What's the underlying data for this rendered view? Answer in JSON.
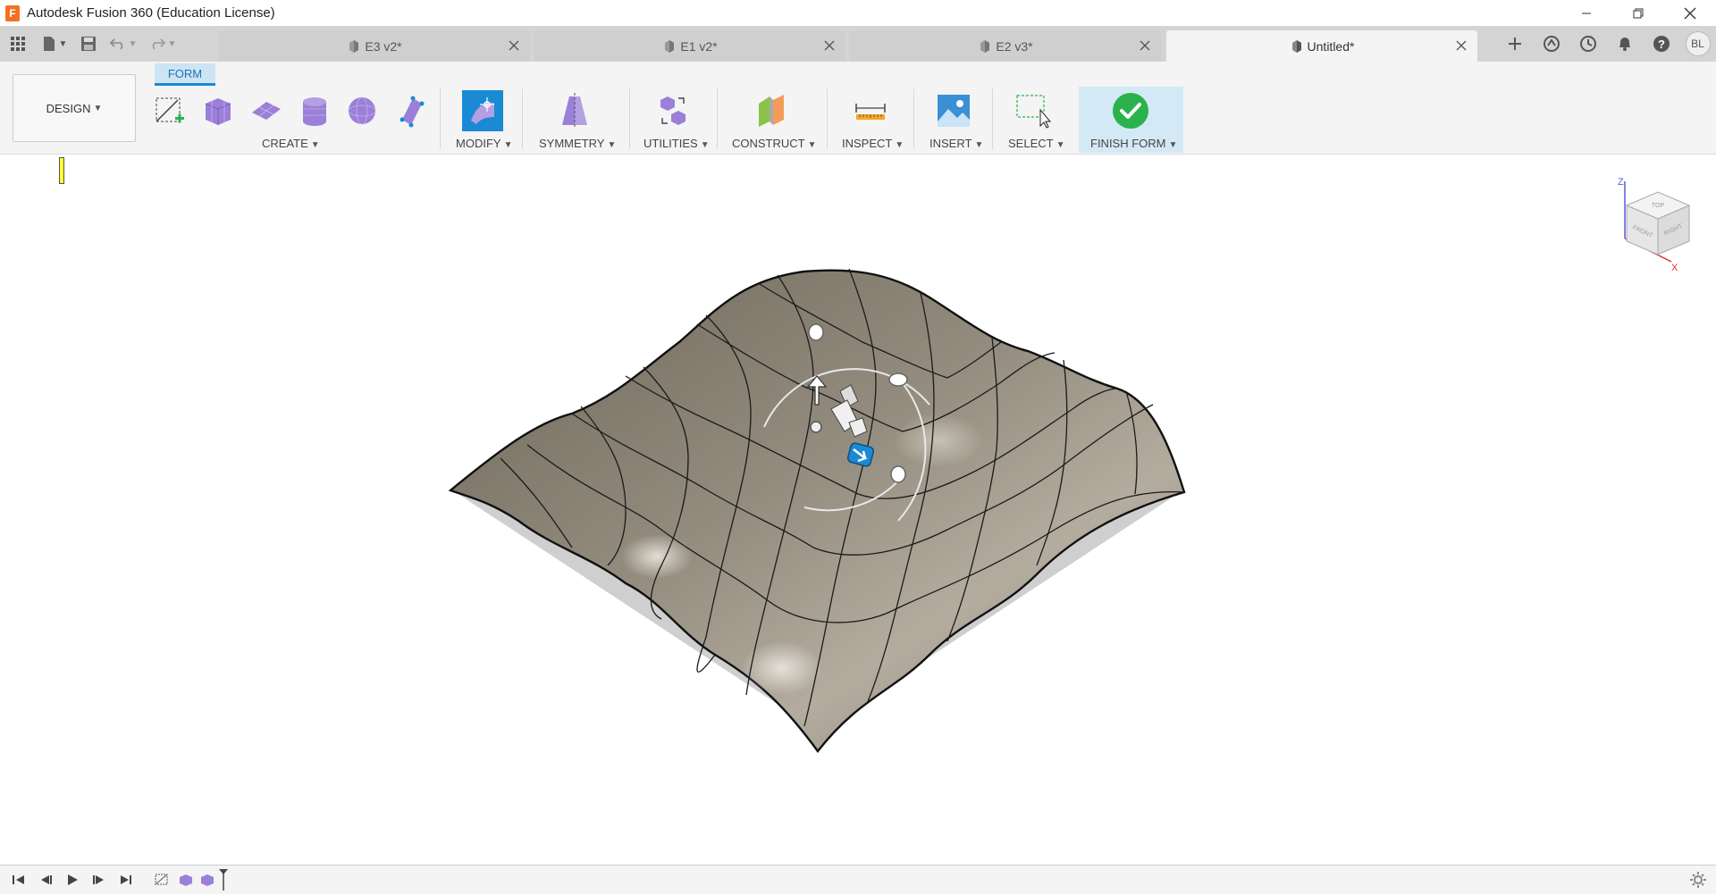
{
  "app": {
    "title": "Autodesk Fusion 360 (Education License)",
    "logo_letter": "F"
  },
  "tabs": [
    {
      "label": "E3 v2*"
    },
    {
      "label": "E1 v2*"
    },
    {
      "label": "E2 v3*"
    },
    {
      "label": "Untitled*"
    }
  ],
  "user": {
    "initials": "BL"
  },
  "workspace": {
    "label": "DESIGN"
  },
  "toolbar": {
    "active_tab": "FORM",
    "groups": {
      "create": "CREATE",
      "modify": "MODIFY",
      "symmetry": "SYMMETRY",
      "utilities": "UTILITIES",
      "construct": "CONSTRUCT",
      "inspect": "INSPECT",
      "insert": "INSERT",
      "select": "SELECT",
      "finish": "FINISH FORM"
    }
  },
  "viewcube": {
    "top": "TOP",
    "front": "FRONT",
    "right": "RIGHT",
    "axis_x": "X",
    "axis_z": "Z"
  },
  "colors": {
    "accent": "#1a8ad4",
    "finish_green": "#2bb24c",
    "surface": "#8a8478",
    "form_purple": "#9b7fd8"
  }
}
